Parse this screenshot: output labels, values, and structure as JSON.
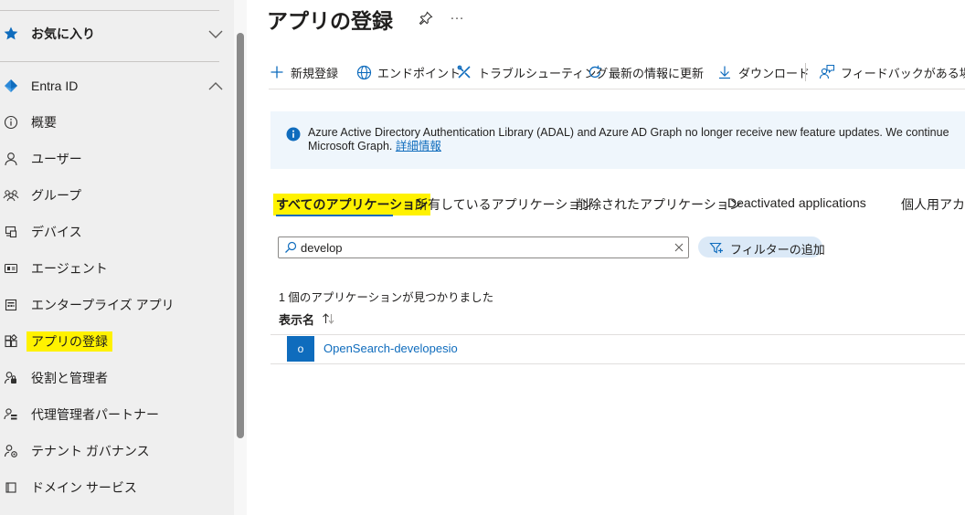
{
  "sidebar": {
    "favorites_label": "お気に入り",
    "section_label": "Entra ID",
    "items": [
      {
        "label": "概要",
        "icon": "info-icon"
      },
      {
        "label": "ユーザー",
        "icon": "user-icon"
      },
      {
        "label": "グループ",
        "icon": "group-icon"
      },
      {
        "label": "デバイス",
        "icon": "devices-icon"
      },
      {
        "label": "エージェント",
        "icon": "agent-icon"
      },
      {
        "label": "エンタープライズ アプリ",
        "icon": "enterprise-app-icon"
      },
      {
        "label": "アプリの登録",
        "icon": "app-registration-icon",
        "selected": true
      },
      {
        "label": "役割と管理者",
        "icon": "roles-icon"
      },
      {
        "label": "代理管理者パートナー",
        "icon": "delegated-admin-icon"
      },
      {
        "label": "テナント ガバナンス",
        "icon": "tenant-governance-icon"
      },
      {
        "label": "ドメイン サービス",
        "icon": "domain-services-icon"
      }
    ]
  },
  "header": {
    "title": "アプリの登録",
    "more": "…"
  },
  "toolbar": {
    "new_registration": "新規登録",
    "endpoints": "エンドポイント",
    "troubleshooting": "トラブルシューティング",
    "refresh": "最新の情報に更新",
    "download": "ダウンロード",
    "feedback": "フィードバックがある場合"
  },
  "banner": {
    "line1": "Azure Active Directory Authentication Library (ADAL) and Azure AD Graph no longer receive new feature updates. We continue",
    "line2_prefix": "Microsoft Graph.",
    "link": "詳細情報"
  },
  "tabs": [
    {
      "label": "すべてのアプリケーション",
      "active": true
    },
    {
      "label": "所有しているアプリケーション"
    },
    {
      "label": "削除されたアプリケーション"
    },
    {
      "label": "Deactivated applications"
    },
    {
      "label": "個人用アカウント"
    }
  ],
  "search": {
    "value": "develop",
    "placeholder": ""
  },
  "filter": {
    "label": "フィルターの追加"
  },
  "results": {
    "count_text": "1 個のアプリケーションが見つかりました",
    "column_display_name": "表示名",
    "rows": [
      {
        "avatar": "o",
        "name": "OpenSearch-developesio"
      }
    ]
  },
  "colors": {
    "accent": "#0f6cbd",
    "highlight": "#fff200",
    "sidebar_bg": "#efefef",
    "banner_bg": "#eff6fc"
  }
}
